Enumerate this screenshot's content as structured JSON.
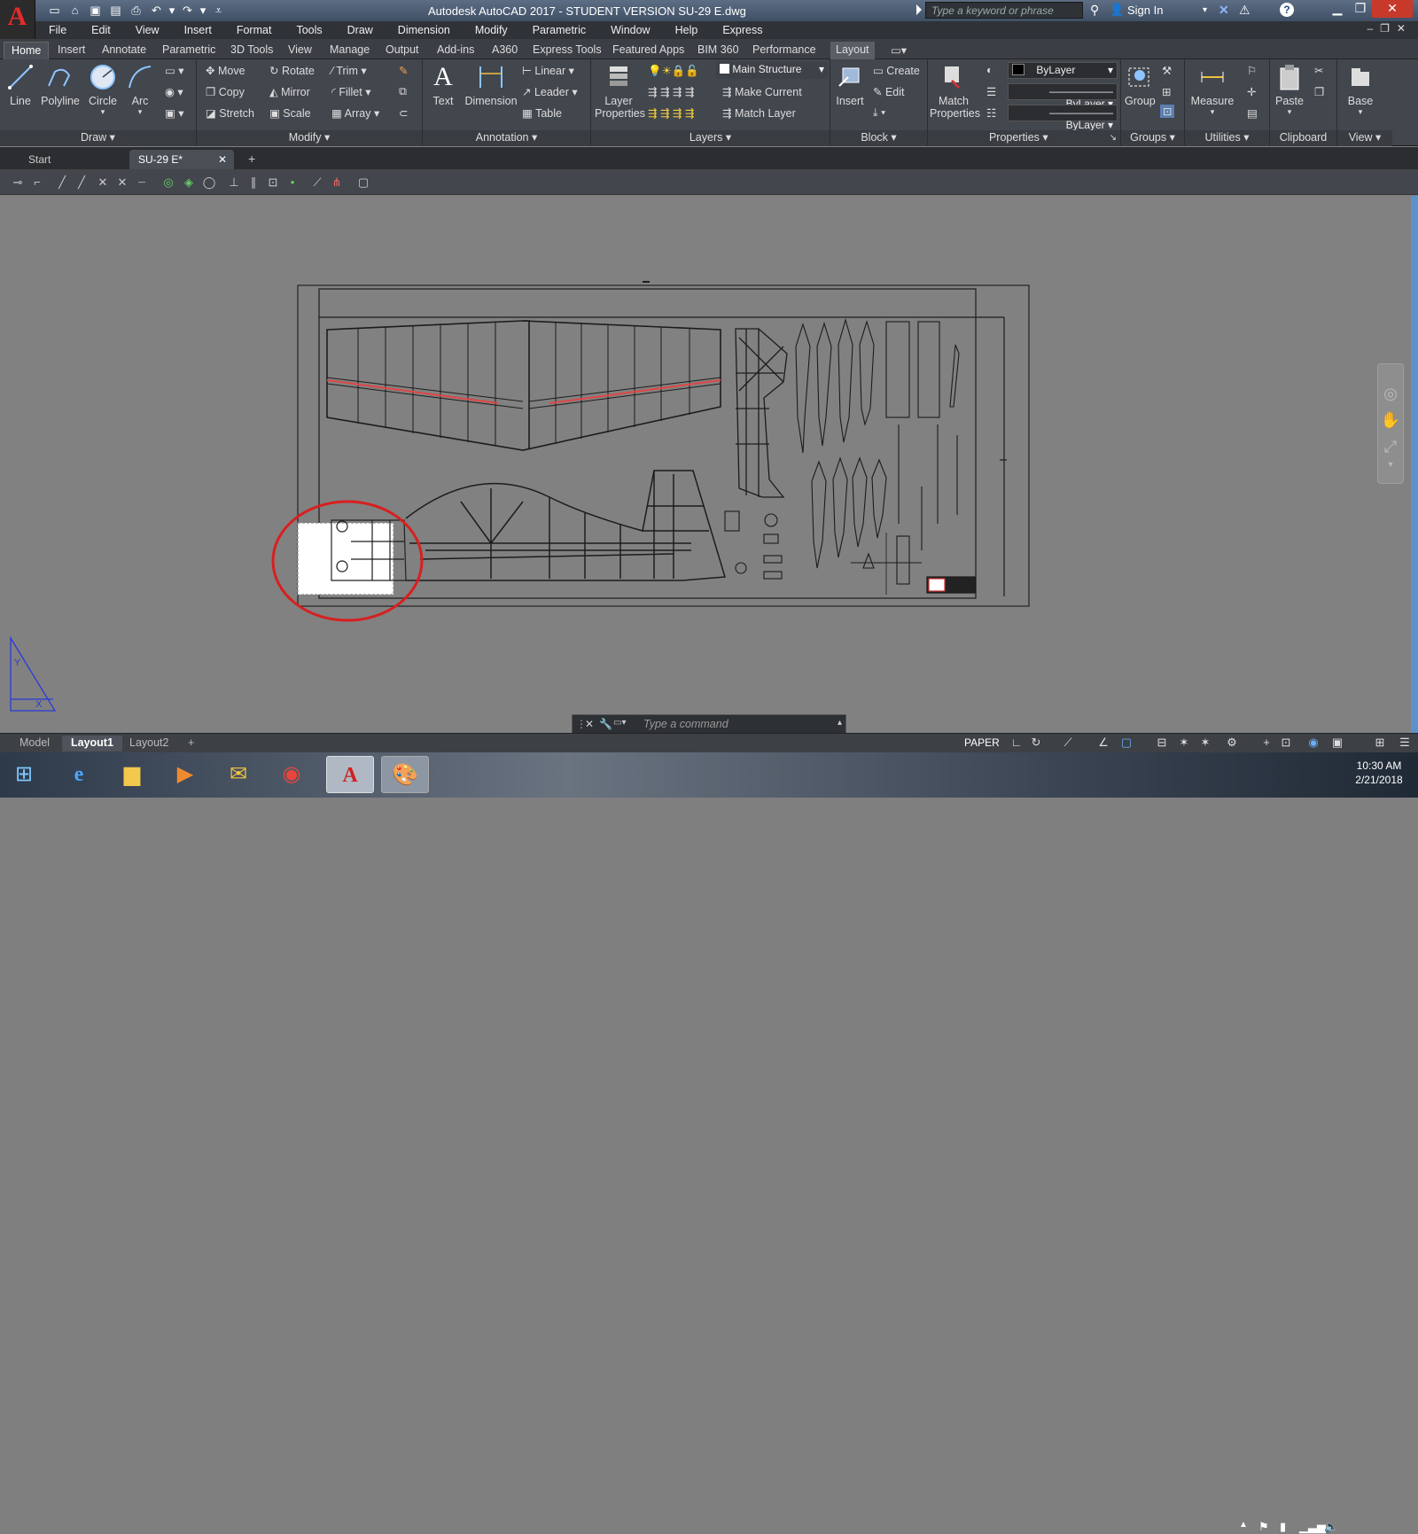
{
  "app": {
    "logo": "A",
    "title": "Autodesk AutoCAD 2017 - STUDENT VERSION    SU-29 E.dwg",
    "search_placeholder": "Type a keyword or phrase",
    "sign_in": "Sign In"
  },
  "menu": [
    "File",
    "Edit",
    "View",
    "Insert",
    "Format",
    "Tools",
    "Draw",
    "Dimension",
    "Modify",
    "Parametric",
    "Window",
    "Help",
    "Express"
  ],
  "ribbon_tabs": [
    "Home",
    "Insert",
    "Annotate",
    "Parametric",
    "3D Tools",
    "View",
    "Manage",
    "Output",
    "Add-ins",
    "A360",
    "Express Tools",
    "Featured Apps",
    "BIM 360",
    "Performance",
    "Layout"
  ],
  "draw": {
    "title": "Draw",
    "line": "Line",
    "polyline": "Polyline",
    "circle": "Circle",
    "arc": "Arc"
  },
  "modify": {
    "title": "Modify",
    "move": "Move",
    "rotate": "Rotate",
    "trim": "Trim",
    "copy": "Copy",
    "mirror": "Mirror",
    "fillet": "Fillet",
    "stretch": "Stretch",
    "scale": "Scale",
    "array": "Array"
  },
  "annotation": {
    "title": "Annotation",
    "text": "Text",
    "dimension": "Dimension",
    "linear": "Linear",
    "leader": "Leader",
    "table": "Table"
  },
  "layers": {
    "title": "Layers",
    "layer_properties_1": "Layer",
    "layer_properties_2": "Properties",
    "current_layer": "Main Structure",
    "make_current": "Make Current",
    "match_layer": "Match Layer"
  },
  "block": {
    "title": "Block",
    "insert": "Insert",
    "create": "Create",
    "edit": "Edit"
  },
  "properties": {
    "title": "Properties",
    "match_1": "Match",
    "match_2": "Properties",
    "color": "ByLayer",
    "linetype": "ByLayer",
    "lineweight": "ByLayer"
  },
  "groups": {
    "title": "Groups",
    "group": "Group"
  },
  "utilities": {
    "title": "Utilities",
    "measure": "Measure"
  },
  "clipboard": {
    "title": "Clipboard",
    "paste": "Paste"
  },
  "view_panel": {
    "title": "View",
    "base": "Base"
  },
  "file_tabs": {
    "start": "Start",
    "drawing": "SU-29 E*"
  },
  "command": {
    "placeholder": "Type a command"
  },
  "layout_tabs": [
    "Model",
    "Layout1",
    "Layout2"
  ],
  "status": {
    "paper": "PAPER"
  },
  "taskbar": {
    "time": "10:30 AM",
    "date": "2/21/2018"
  },
  "colors": {
    "accent_red": "#e32b2b",
    "highlight_circle": "#d81f1f",
    "ribbon": "#42464d",
    "canvas": "#818181"
  }
}
